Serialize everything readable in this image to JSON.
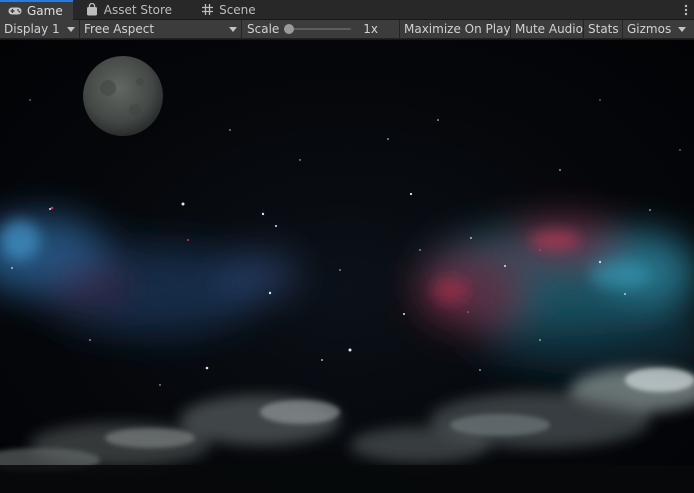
{
  "tabs": [
    {
      "label": "Game",
      "icon": "gamepad-icon",
      "active": true
    },
    {
      "label": "Asset Store",
      "icon": "shopping-bag-icon",
      "active": false
    },
    {
      "label": "Scene",
      "icon": "grid-icon",
      "active": false
    }
  ],
  "toolbar": {
    "display": "Display 1",
    "aspect": "Free Aspect",
    "scale_label": "Scale",
    "scale_value": "1x",
    "scale_level": 0,
    "maximize_label": "Maximize On Play",
    "mute_label": "Mute Audio",
    "stats_label": "Stats",
    "gizmos_label": "Gizmos"
  },
  "colors": {
    "tab_active_accent": "#2b7bd8",
    "toolbar_bg": "#3c3c3c",
    "tabbar_bg": "#282828"
  },
  "game_view": {
    "scene": "night sky with moon, nebula and clouds"
  }
}
